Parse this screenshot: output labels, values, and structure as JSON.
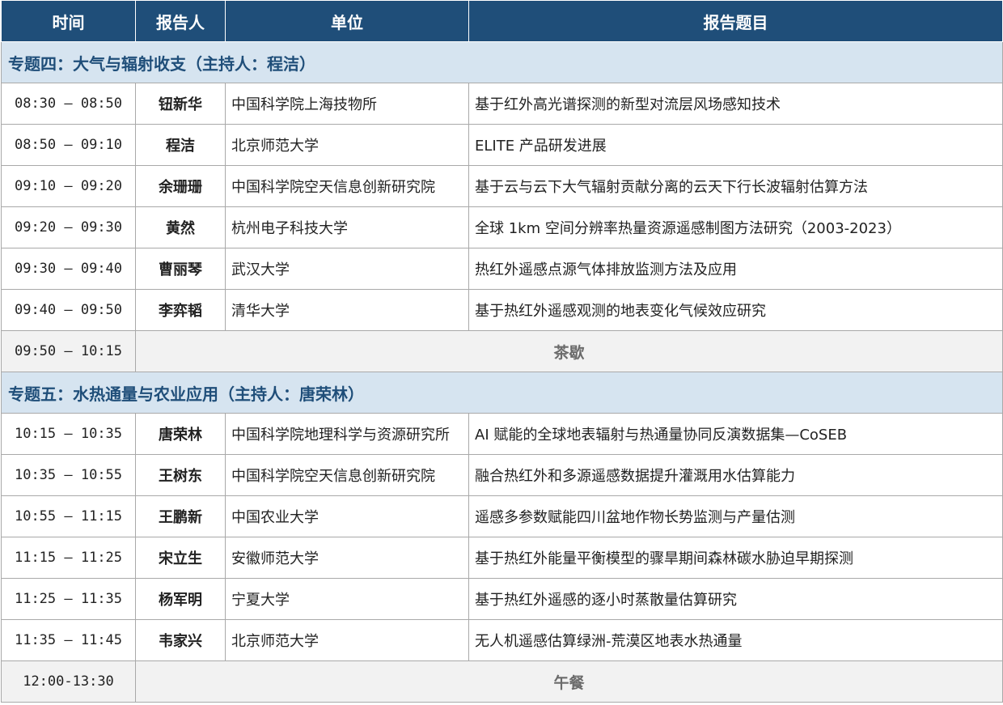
{
  "header": {
    "time": "时间",
    "speaker": "报告人",
    "unit": "单位",
    "title": "报告题目"
  },
  "section4": {
    "title": "专题四：大气与辐射收支（主持人：程洁）",
    "rows": [
      {
        "time": "08:30 – 08:50",
        "speaker": "钮新华",
        "unit": "中国科学院上海技物所",
        "title": "基于红外高光谱探测的新型对流层风场感知技术"
      },
      {
        "time": "08:50 – 09:10",
        "speaker": "程洁",
        "unit": "北京师范大学",
        "title": "ELITE 产品研发进展"
      },
      {
        "time": "09:10 – 09:20",
        "speaker": "余珊珊",
        "unit": "中国科学院空天信息创新研究院",
        "title": "基于云与云下大气辐射贡献分离的云天下行长波辐射估算方法"
      },
      {
        "time": "09:20 – 09:30",
        "speaker": "黄然",
        "unit": "杭州电子科技大学",
        "title": "全球 1km 空间分辨率热量资源遥感制图方法研究（2003-2023）"
      },
      {
        "time": "09:30 – 09:40",
        "speaker": "曹丽琴",
        "unit": "武汉大学",
        "title": "热红外遥感点源气体排放监测方法及应用"
      },
      {
        "time": "09:40 – 09:50",
        "speaker": "李弈韬",
        "unit": "清华大学",
        "title": "基于热红外遥感观测的地表变化气候效应研究"
      }
    ],
    "break": {
      "time": "09:50 – 10:15",
      "label": "茶歇"
    }
  },
  "section5": {
    "title": "专题五：水热通量与农业应用（主持人：唐荣林）",
    "rows": [
      {
        "time": "10:15 – 10:35",
        "speaker": "唐荣林",
        "unit": "中国科学院地理科学与资源研究所",
        "title": "AI 赋能的全球地表辐射与热通量协同反演数据集—CoSEB"
      },
      {
        "time": "10:35 – 10:55",
        "speaker": "王树东",
        "unit": "中国科学院空天信息创新研究院",
        "title": "融合热红外和多源遥感数据提升灌溉用水估算能力"
      },
      {
        "time": "10:55 – 11:15",
        "speaker": "王鹏新",
        "unit": "中国农业大学",
        "title": "遥感多参数赋能四川盆地作物长势监测与产量估测"
      },
      {
        "time": "11:15 – 11:25",
        "speaker": "宋立生",
        "unit": "安徽师范大学",
        "title": "基于热红外能量平衡模型的骤旱期间森林碳水胁迫早期探测"
      },
      {
        "time": "11:25 – 11:35",
        "speaker": "杨军明",
        "unit": "宁夏大学",
        "title": "基于热红外遥感的逐小时蒸散量估算研究"
      },
      {
        "time": "11:35 – 11:45",
        "speaker": "韦家兴",
        "unit": "北京师范大学",
        "title": "无人机遥感估算绿洲-荒漠区地表水热通量"
      }
    ],
    "break": {
      "time": "12:00-13:30",
      "label": "午餐"
    }
  },
  "colors": {
    "header_bg": "#1f4e79",
    "section_bg": "#d6e4f0",
    "break_bg": "#f2f2f2"
  }
}
